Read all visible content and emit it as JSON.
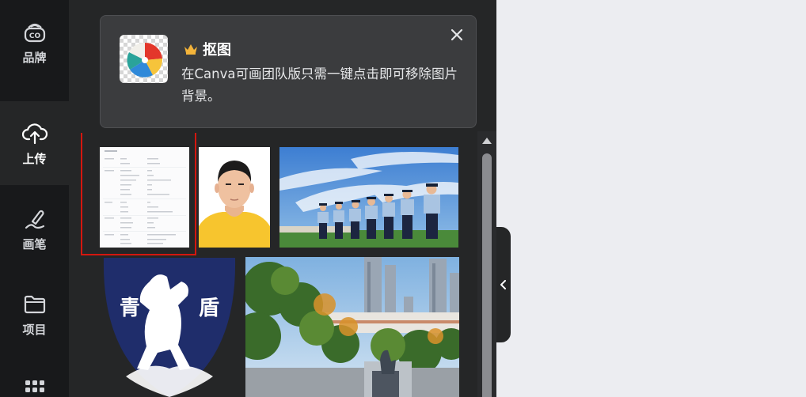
{
  "rail": {
    "items": [
      {
        "id": "brand",
        "label": "品牌",
        "icon": "brand-kit-icon"
      },
      {
        "id": "upload",
        "label": "上传",
        "icon": "cloud-upload-icon"
      },
      {
        "id": "draw",
        "label": "画笔",
        "icon": "pen-draw-icon"
      },
      {
        "id": "projects",
        "label": "项目",
        "icon": "folder-icon"
      },
      {
        "id": "apps",
        "label": "",
        "icon": "apps-grid-icon"
      }
    ]
  },
  "promo": {
    "title": "抠图",
    "description": "在Canva可画团队版只需一键点击即可移除图片背景。",
    "crown_icon": "crown-icon",
    "close_icon": "close-icon",
    "crown_color": "#f4b43a"
  },
  "uploads": {
    "items": [
      {
        "id": "document-screenshot",
        "kind": "document",
        "selected": true
      },
      {
        "id": "portrait-photo",
        "kind": "photo"
      },
      {
        "id": "police-parade-photo",
        "kind": "photo"
      },
      {
        "id": "qingdun-emblem",
        "kind": "logo",
        "emblem_text_left": "青",
        "emblem_text_right": "盾"
      },
      {
        "id": "campus-statue-photo",
        "kind": "photo"
      }
    ],
    "selection_color": "#d4170f"
  },
  "collapse": {
    "icon": "chevron-left-icon"
  }
}
